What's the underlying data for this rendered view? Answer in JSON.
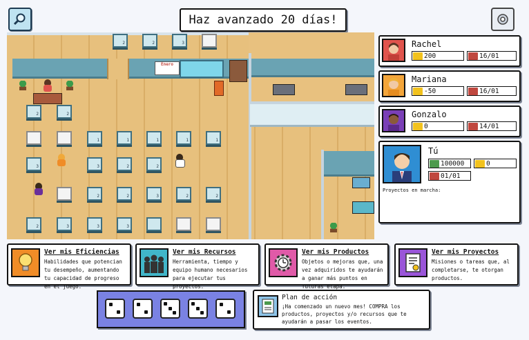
{
  "header": {
    "title": "Haz avanzado 20 días!",
    "search_icon": "magnifier-icon",
    "settings_icon": "gear-icon"
  },
  "players": [
    {
      "name": "Rachel",
      "trophies": "200",
      "date": "16/01",
      "avatar_color": "#e0544d"
    },
    {
      "name": "Mariana",
      "trophies": "-50",
      "date": "16/01",
      "avatar_color": "#f3a53a"
    },
    {
      "name": "Gonzalo",
      "trophies": "0",
      "date": "14/01",
      "avatar_color": "#7a3fb6"
    }
  ],
  "me": {
    "name": "Tú",
    "money": "100000",
    "trophies": "0",
    "date": "01/01",
    "projects_label": "Proyectos en marcha:",
    "avatar_color": "#2f8ed3"
  },
  "map": {
    "calendar_label": "Enero",
    "desk_numbers": [
      "2",
      "2",
      "3",
      "2",
      "2",
      "1",
      "1",
      "1",
      "1",
      "1",
      "3",
      "3",
      "2",
      "2",
      "2",
      "2",
      "3",
      "2",
      "2",
      "2",
      "3",
      "3",
      "3"
    ]
  },
  "cards": [
    {
      "title": "Ver mis Eficiencias",
      "desc": "Habilidades que potencian tu desempeño, aumentando tu capacidad de progreso en el juego.",
      "color": "#f08c27",
      "icon": "lightbulb-icon"
    },
    {
      "title": "Ver mis Recursos",
      "desc": "Herramienta, tiempo y equipo humano necesarios para ejecutar tus proyectos.",
      "color": "#41b6c9",
      "icon": "crowd-icon"
    },
    {
      "title": "Ver mis Productos",
      "desc": "Objetos o mejoras que, una vez adquiridos te ayudarán a ganar más puntos en futuras etapa.",
      "color": "#e05aa8",
      "icon": "gear-clock-icon"
    },
    {
      "title": "Ver mis Proyectos",
      "desc": "Misiones o tareas que, al completarse, te otorgan productos.",
      "color": "#9a55d9",
      "icon": "checklist-icon"
    }
  ],
  "dice": [
    2,
    2,
    3,
    3,
    2
  ],
  "plan": {
    "title": "Plan de acción",
    "desc": "¡Ha comenzado un nuevo mes! COMPRA los productos, proyectos y/o recursos que te ayudarán a pasar los eventos.",
    "icon": "document-icon"
  }
}
